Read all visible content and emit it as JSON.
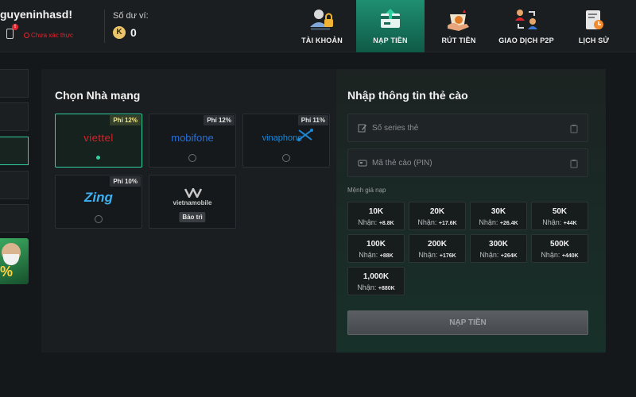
{
  "header": {
    "username": "guyeninhasd!",
    "verify_status": "Chưa xác thực",
    "phone_badge": "!",
    "balance_label": "Số dư ví:",
    "coin_symbol": "K",
    "balance_value": "0"
  },
  "nav": [
    {
      "label": "TÀI KHOẢN",
      "icon": "account-icon",
      "active": false
    },
    {
      "label": "NẠP TIỀN",
      "icon": "deposit-icon",
      "active": true
    },
    {
      "label": "RÚT TIỀN",
      "icon": "withdraw-icon",
      "active": false
    },
    {
      "label": "GIAO DỊCH P2P",
      "icon": "p2p-icon",
      "active": false
    },
    {
      "label": "LỊCH SỬ",
      "icon": "history-icon",
      "active": false
    }
  ],
  "carriers": {
    "title": "Chọn Nhà mạng",
    "items": [
      {
        "name": "viettel",
        "fee": "Phí 12%",
        "selected": true,
        "color": "#e01f26"
      },
      {
        "name": "mobifone",
        "fee": "Phí 12%",
        "selected": false,
        "color": "#2a6fd6"
      },
      {
        "name": "vinaphone",
        "fee": "Phí 11%",
        "selected": false,
        "color": "#1c88d8"
      },
      {
        "name": "Zing",
        "fee": "Phí 10%",
        "selected": false,
        "color": "#3fb0f0"
      },
      {
        "name": "vietnamobile",
        "maintenance": "Bảo trì",
        "selected": false,
        "color": "#c9c9c9"
      }
    ]
  },
  "card_form": {
    "title": "Nhập thông tin thẻ cào",
    "serial_placeholder": "Số series thẻ",
    "pin_placeholder": "Mã thẻ cào (PIN)",
    "amount_label": "Mệnh giá nạp",
    "receive_prefix": "Nhận:",
    "amounts": [
      {
        "value": "10K",
        "receive": "+8.8K"
      },
      {
        "value": "20K",
        "receive": "+17.6K"
      },
      {
        "value": "30K",
        "receive": "+26.4K"
      },
      {
        "value": "50K",
        "receive": "+44K"
      },
      {
        "value": "100K",
        "receive": "+88K"
      },
      {
        "value": "200K",
        "receive": "+176K"
      },
      {
        "value": "300K",
        "receive": "+264K"
      },
      {
        "value": "500K",
        "receive": "+440K"
      },
      {
        "value": "1,000K",
        "receive": "+880K"
      }
    ],
    "submit_label": "NẠP TIỀN"
  },
  "colors": {
    "accent": "#2fcf9f",
    "active_nav": "#1f8f72",
    "danger": "#e0262e",
    "coin": "#e9c46a"
  }
}
